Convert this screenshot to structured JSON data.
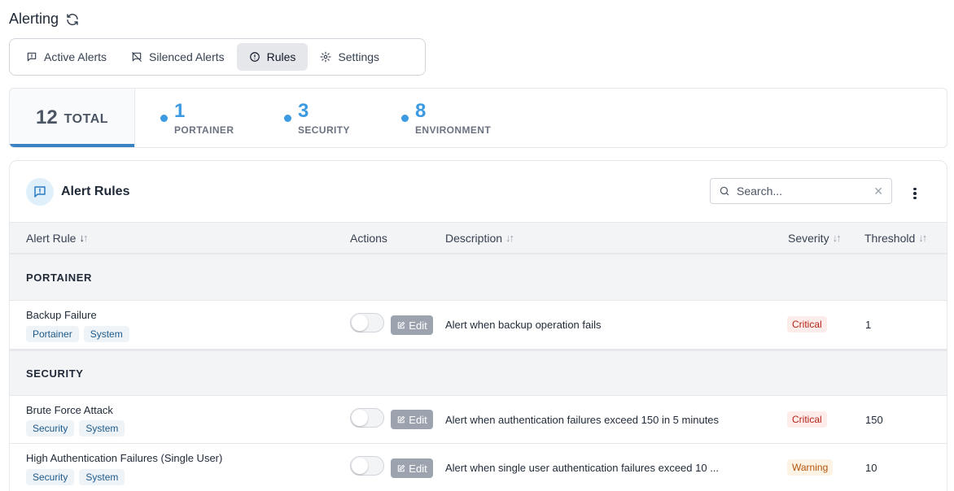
{
  "page": {
    "title": "Alerting"
  },
  "tabs": [
    {
      "label": "Active Alerts",
      "icon": "message-alert-icon"
    },
    {
      "label": "Silenced Alerts",
      "icon": "message-off-icon"
    },
    {
      "label": "Rules",
      "icon": "alert-circle-icon",
      "active": true
    },
    {
      "label": "Settings",
      "icon": "gear-icon"
    }
  ],
  "stats": {
    "total": {
      "value": "12",
      "label": "TOTAL"
    },
    "items": [
      {
        "value": "1",
        "label": "PORTAINER"
      },
      {
        "value": "3",
        "label": "SECURITY"
      },
      {
        "value": "8",
        "label": "ENVIRONMENT"
      }
    ]
  },
  "card": {
    "title": "Alert Rules",
    "search": {
      "placeholder": "Search...",
      "value": ""
    }
  },
  "table": {
    "columns": [
      "Alert Rule",
      "Actions",
      "Description",
      "Severity",
      "Threshold"
    ],
    "groups": [
      {
        "name": "PORTAINER",
        "rows": [
          {
            "name": "Backup Failure",
            "tags": [
              "Portainer",
              "System"
            ],
            "edit_label": "Edit",
            "description": "Alert when backup operation fails",
            "severity": "Critical",
            "threshold": "1"
          }
        ]
      },
      {
        "name": "SECURITY",
        "rows": [
          {
            "name": "Brute Force Attack",
            "tags": [
              "Security",
              "System"
            ],
            "edit_label": "Edit",
            "description": "Alert when authentication failures exceed 150 in 5 minutes",
            "severity": "Critical",
            "threshold": "150"
          },
          {
            "name": "High Authentication Failures (Single User)",
            "tags": [
              "Security",
              "System"
            ],
            "edit_label": "Edit",
            "description": "Alert when single user authentication failures exceed 10 ...",
            "severity": "Warning",
            "threshold": "10"
          }
        ]
      }
    ]
  },
  "colors": {
    "accent": "#3b9ae1",
    "critical": "#b42318",
    "warning": "#b45309",
    "tag_text": "#1e5a8a"
  }
}
